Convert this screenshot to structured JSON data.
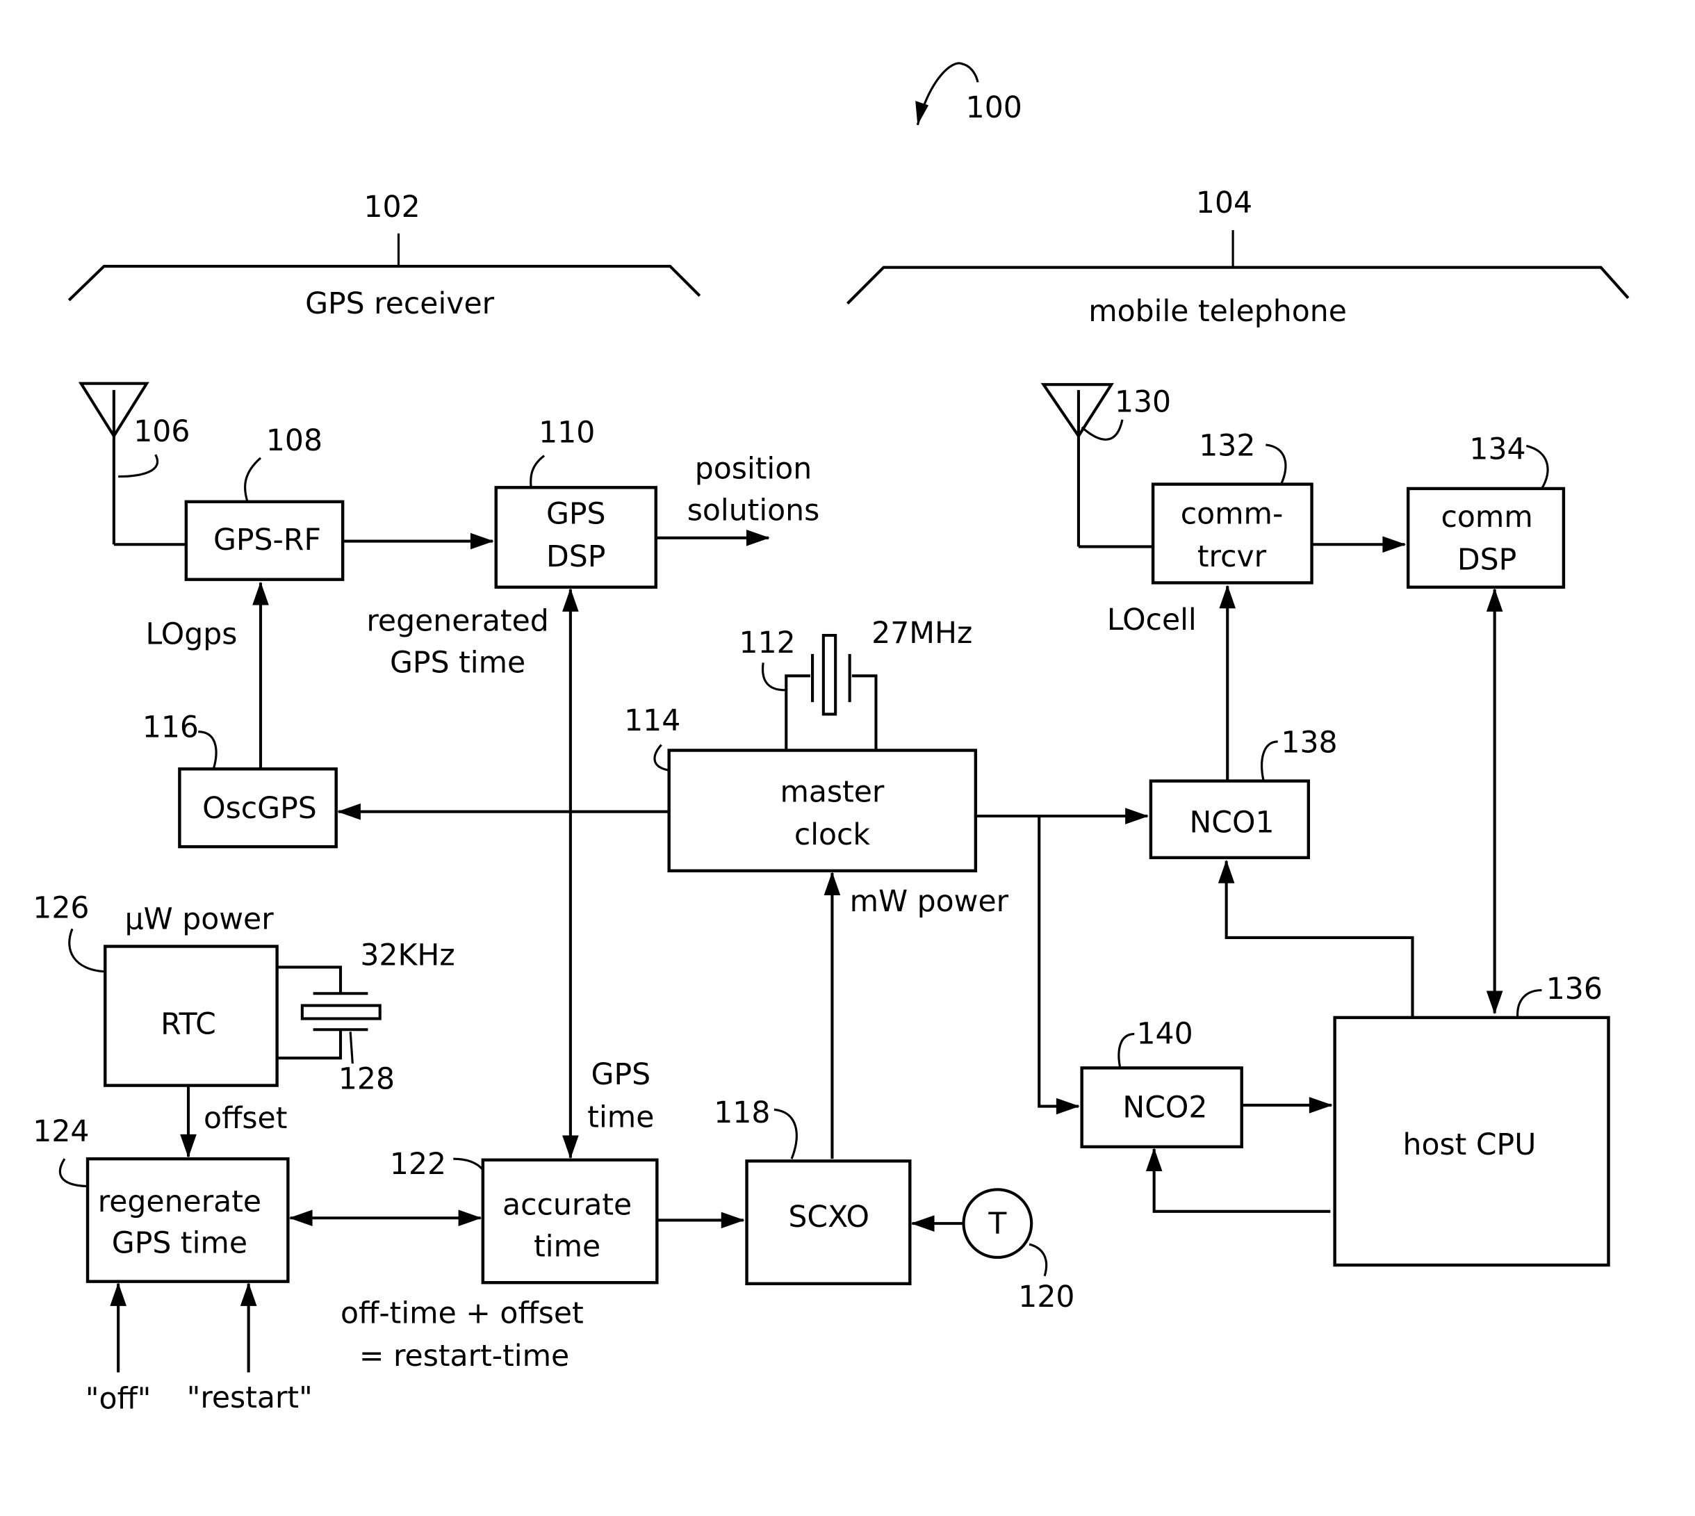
{
  "figure": {
    "ref": "100",
    "colors": {
      "ink": "#000000",
      "paper": "#ffffff"
    }
  },
  "groups": {
    "gps_receiver": {
      "ref": "102",
      "label": "GPS receiver"
    },
    "mobile_telephone": {
      "ref": "104",
      "label": "mobile telephone"
    }
  },
  "blocks": {
    "gps_rf": {
      "ref": "108",
      "label": "GPS-RF"
    },
    "gps_dsp": {
      "ref": "110",
      "line1": "GPS",
      "line2": "DSP"
    },
    "osc_gps": {
      "ref": "116",
      "label": "OscGPS"
    },
    "master_clock": {
      "ref": "114",
      "line1": "master",
      "line2": "clock"
    },
    "rtc": {
      "ref": "126",
      "label": "RTC"
    },
    "regen": {
      "ref": "124",
      "line1": "regenerate",
      "line2": "GPS time"
    },
    "accurate": {
      "ref": "122",
      "line1": "accurate",
      "line2": "time"
    },
    "scxo": {
      "ref": "118",
      "label": "SCXO"
    },
    "temp": {
      "ref": "120",
      "label": "T"
    },
    "comm_trcvr": {
      "ref": "132",
      "line1": "comm-",
      "line2": "trcvr"
    },
    "comm_dsp": {
      "ref": "134",
      "line1": "comm",
      "line2": "DSP"
    },
    "nco1": {
      "ref": "138",
      "label": "NCO1"
    },
    "nco2": {
      "ref": "140",
      "label": "NCO2"
    },
    "host_cpu": {
      "ref": "136",
      "label": "host CPU"
    }
  },
  "components": {
    "gps_antenna": {
      "ref": "106"
    },
    "cell_antenna": {
      "ref": "130"
    },
    "crystal_27": {
      "ref": "112",
      "label": "27MHz"
    },
    "crystal_32": {
      "ref": "128",
      "label": "32KHz"
    }
  },
  "signals": {
    "position": {
      "line1": "position",
      "line2": "solutions"
    },
    "regen_gps_time": {
      "line1": "regenerated",
      "line2": "GPS time"
    },
    "lo_gps": "LOgps",
    "lo_cell": "LOcell",
    "mw_power": "mW power",
    "uw_power": "µW power",
    "offset": "offset",
    "gps_time": {
      "line1": "GPS",
      "line2": "time"
    },
    "equation": {
      "line1": "off-time + offset",
      "line2": "= restart-time"
    },
    "off": "\"off\"",
    "restart": "\"restart\""
  }
}
